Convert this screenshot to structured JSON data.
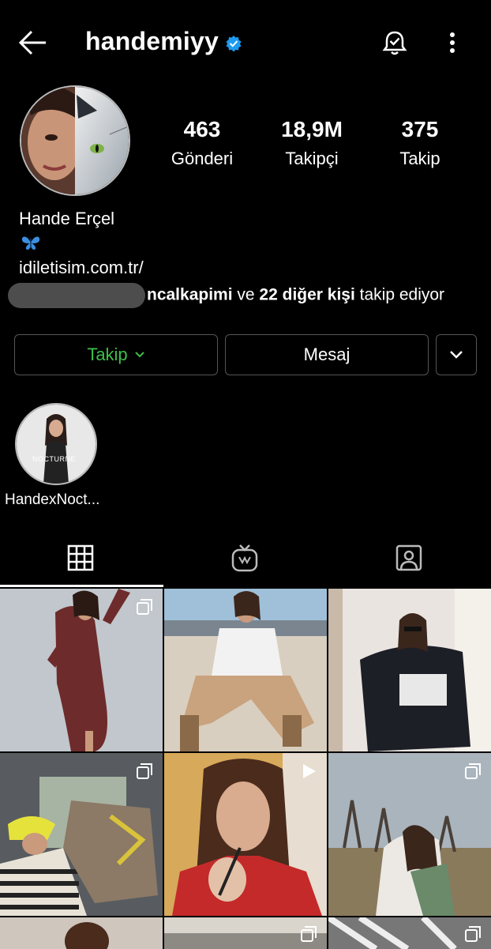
{
  "header": {
    "username": "handemiyy",
    "icons": [
      "back-arrow-icon",
      "verified-badge-icon",
      "notification-bell-icon",
      "more-options-icon"
    ]
  },
  "profile": {
    "stats": [
      {
        "value": "463",
        "label": "Gönderi"
      },
      {
        "value": "18,9M",
        "label": "Takipçi"
      },
      {
        "value": "375",
        "label": "Takip"
      }
    ],
    "full_name": "Hande Erçel",
    "bio_emoji": "🦋",
    "link": "idiletisim.com.tr/",
    "followed_by": {
      "visible_user": "ncalkapimi",
      "connector": " ve ",
      "others": "22 diğer kişi",
      "suffix": " takip ediyor"
    }
  },
  "actions": {
    "follow_label": "Takip",
    "message_label": "Mesaj"
  },
  "highlights": [
    {
      "label": "HandexNoct...",
      "cover_text": "NOCTURNE"
    }
  ],
  "tabs": [
    "grid-tab",
    "igtv-tab",
    "tagged-tab"
  ],
  "colors": {
    "accent_green": "#3fbf4a",
    "verified_blue": "#1d9bf0",
    "background": "#000000"
  }
}
